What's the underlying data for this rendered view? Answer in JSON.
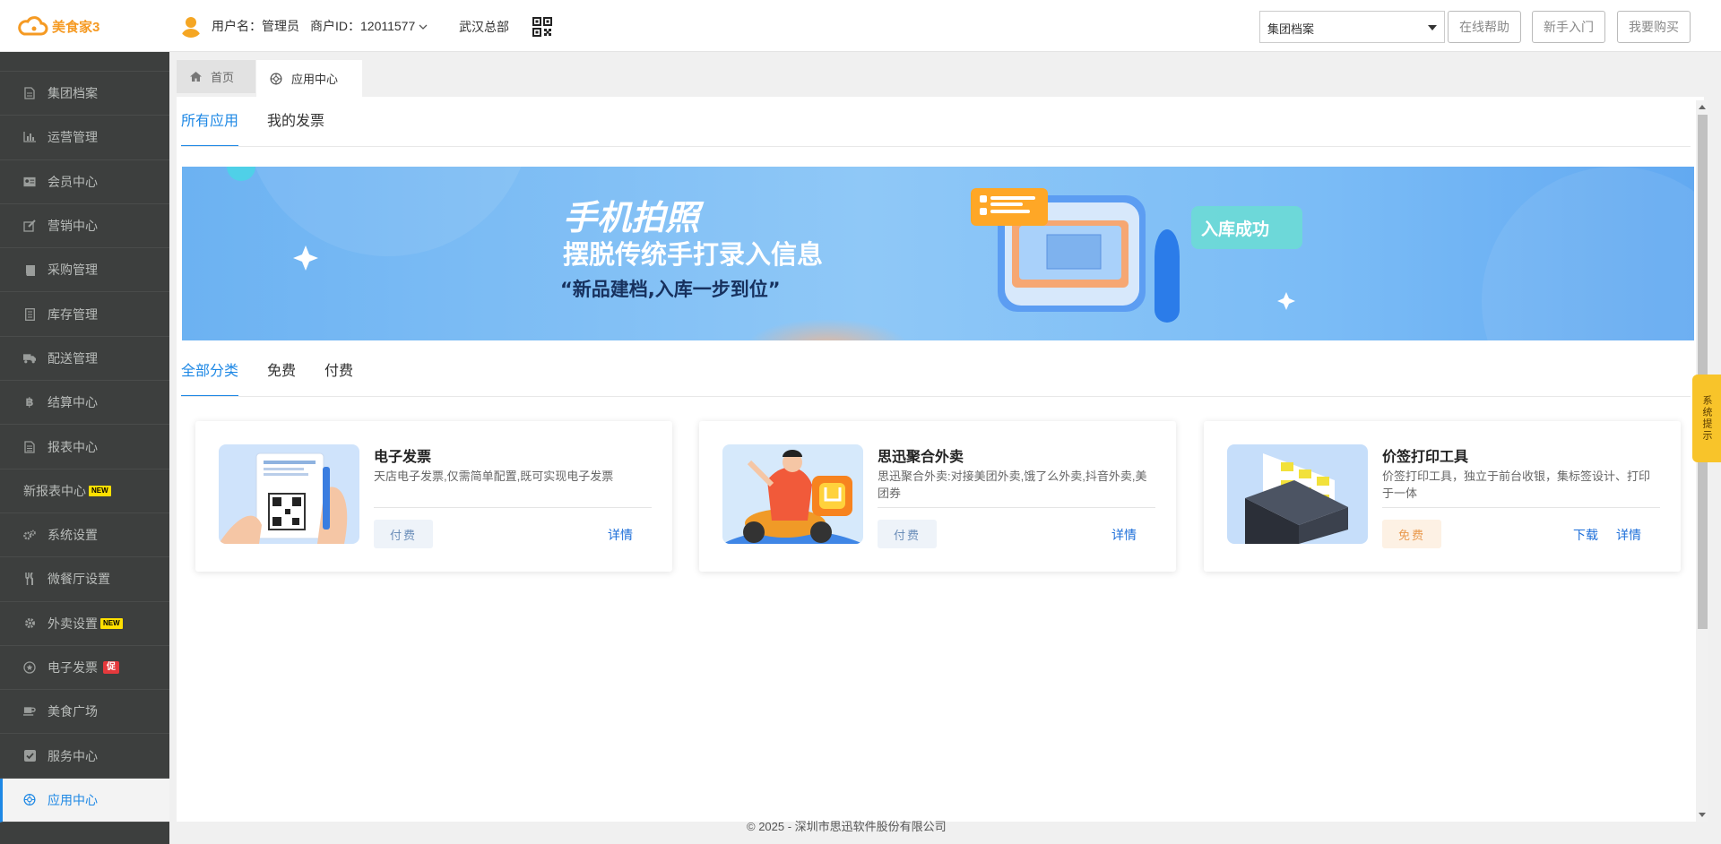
{
  "header": {
    "app_name": "美食家3",
    "user_label": "用户名：管理员",
    "merchant_label": "商户ID：12011577",
    "store_name": "武汉总部",
    "select_value": "集团档案",
    "help_button": "在线帮助",
    "beginner_button": "新手入门",
    "buy_button": "我要购买"
  },
  "sidebar": {
    "items": [
      {
        "label": "集团档案",
        "icon": "file-icon"
      },
      {
        "label": "运营管理",
        "icon": "bar-chart-icon"
      },
      {
        "label": "会员中心",
        "icon": "member-card-icon"
      },
      {
        "label": "营销中心",
        "icon": "edit-icon"
      },
      {
        "label": "采购管理",
        "icon": "book-icon"
      },
      {
        "label": "库存管理",
        "icon": "document-icon"
      },
      {
        "label": "配送管理",
        "icon": "truck-icon"
      },
      {
        "label": "结算中心",
        "icon": "bitcoin-icon"
      },
      {
        "label": "报表中心",
        "icon": "report-icon"
      },
      {
        "label": "新报表中心",
        "badge": "NEW"
      },
      {
        "label": "系统设置",
        "icon": "gears-icon"
      },
      {
        "label": "微餐厅设置",
        "icon": "cutlery-icon"
      },
      {
        "label": "外卖设置",
        "icon": "gear-icon",
        "badge": "NEW"
      },
      {
        "label": "电子发票",
        "icon": "star-circle-icon",
        "promo": "促"
      },
      {
        "label": "美食广场",
        "icon": "coffee-icon"
      },
      {
        "label": "服务中心",
        "icon": "check-square-icon"
      },
      {
        "label": "应用中心",
        "icon": "app-center-icon"
      }
    ]
  },
  "page_tabs": {
    "home": "首页",
    "current": "应用中心"
  },
  "main_tabs": [
    "所有应用",
    "我的发票"
  ],
  "banner": {
    "title": "手机拍照",
    "subtitle": "摆脱传统手打录入信息",
    "slogan": "“新品建档,入库一步到位”",
    "success_label": "入库成功"
  },
  "category_tabs": [
    "全部分类",
    "免费",
    "付费"
  ],
  "cards": [
    {
      "title": "电子发票",
      "desc": "天店电子发票,仅需简单配置,既可实现电子发票",
      "tag": "付费",
      "tag_type": "paid",
      "links": [
        "详情"
      ]
    },
    {
      "title": "思迅聚合外卖",
      "desc": "思迅聚合外卖:对接美团外卖,饿了么外卖,抖音外卖,美团券",
      "tag": "付费",
      "tag_type": "paid",
      "links": [
        "详情"
      ]
    },
    {
      "title": "价签打印工具",
      "desc": "价签打印工具，独立于前台收银，集标签设计、打印于一体",
      "tag": "免费",
      "tag_type": "free",
      "links": [
        "下载",
        "详情"
      ]
    }
  ],
  "footer": "© 2025 - 深圳市思迅软件股份有限公司",
  "side_tip": "系统提示",
  "colors": {
    "accent": "#1e88e5",
    "sidebar_bg": "#3d3f3e",
    "brand": "#f59a23"
  }
}
